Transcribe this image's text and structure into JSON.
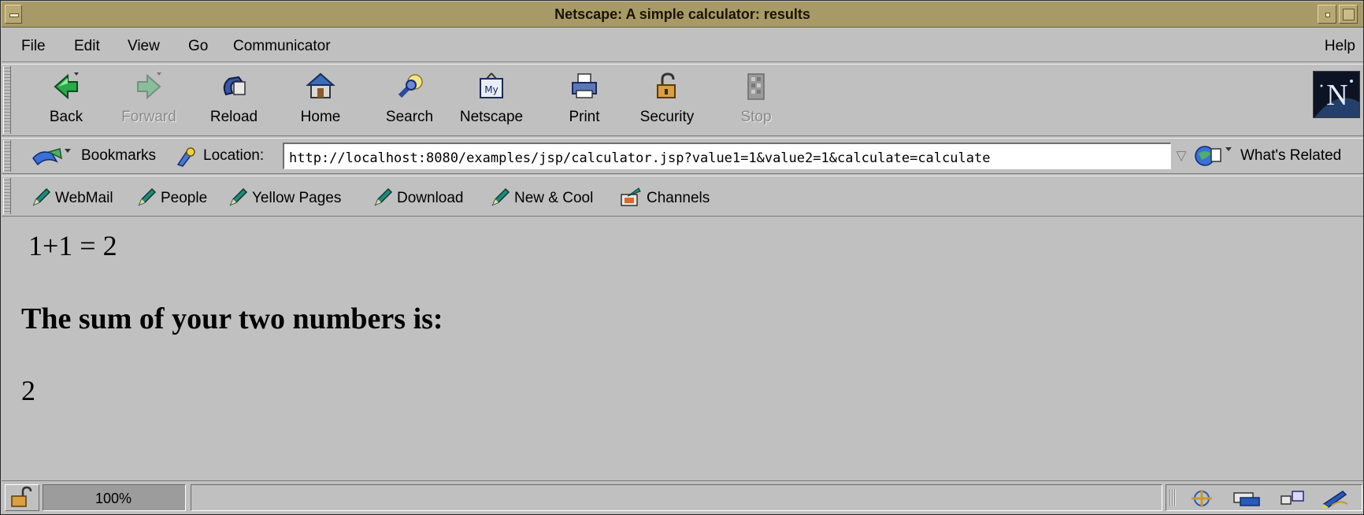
{
  "window": {
    "title": "Netscape: A simple calculator: results"
  },
  "menubar": {
    "items": [
      "File",
      "Edit",
      "View",
      "Go",
      "Communicator"
    ],
    "help": "Help"
  },
  "nav_toolbar": {
    "buttons": [
      {
        "label": "Back",
        "icon": "back-arrow-icon",
        "enabled": true
      },
      {
        "label": "Forward",
        "icon": "forward-arrow-icon",
        "enabled": false
      },
      {
        "label": "Reload",
        "icon": "reload-icon",
        "enabled": true
      },
      {
        "label": "Home",
        "icon": "home-icon",
        "enabled": true
      },
      {
        "label": "Search",
        "icon": "search-icon",
        "enabled": true
      },
      {
        "label": "Netscape",
        "icon": "my-netscape-icon",
        "enabled": true
      },
      {
        "label": "Print",
        "icon": "print-icon",
        "enabled": true
      },
      {
        "label": "Security",
        "icon": "security-lock-icon",
        "enabled": true
      },
      {
        "label": "Stop",
        "icon": "stop-icon",
        "enabled": false
      }
    ],
    "logo": "N"
  },
  "location_toolbar": {
    "bookmarks_label": "Bookmarks",
    "location_label": "Location:",
    "url": "http://localhost:8080/examples/jsp/calculator.jsp?value1=1&value2=1&calculate=calculate",
    "related_label": "What's Related"
  },
  "personal_toolbar": {
    "links": [
      "WebMail",
      "People",
      "Yellow Pages",
      "Download",
      "New & Cool",
      "Channels"
    ]
  },
  "content": {
    "expression": "1+1 = 2",
    "heading": "The sum of your two numbers is:",
    "result": "2"
  },
  "statusbar": {
    "progress_text": "100%",
    "message": ""
  },
  "colors": {
    "chrome": "#c0c0c0",
    "titlebar": "#a89a66",
    "link_pencil": "#1f8a7a"
  }
}
